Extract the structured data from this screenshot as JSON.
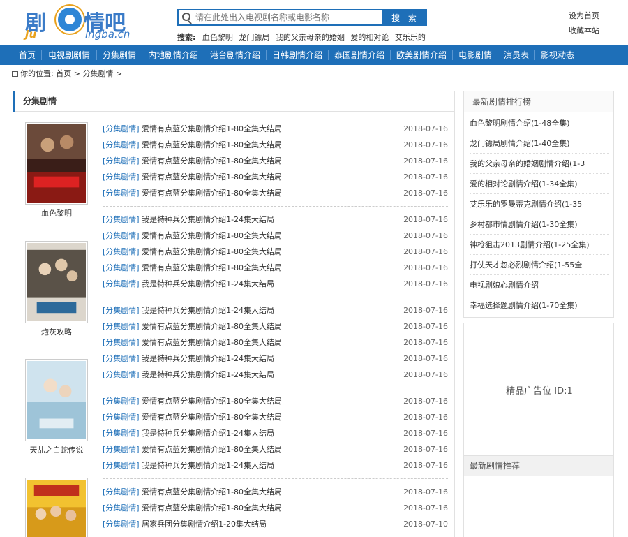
{
  "logo": {
    "brand_cn_left": "剧",
    "brand_cn_right": "情吧",
    "brand_en_left": "Ju",
    "brand_en_right": "ingba.cn"
  },
  "search": {
    "placeholder": "请在此处出入电视剧名称或电影名称",
    "button_label": "搜 索"
  },
  "hot": {
    "label": "搜索:",
    "keywords": [
      "血色黎明",
      "龙门镖局",
      "我的父亲母亲的婚姻",
      "爱的相对论",
      "艾乐乐的"
    ]
  },
  "toplinks": {
    "homepage": "设为首页",
    "favorite": "收藏本站"
  },
  "nav": [
    "首页",
    "电视剧剧情",
    "分集剧情",
    "内地剧情介绍",
    "港台剧情介绍",
    "日韩剧情介绍",
    "泰国剧情介绍",
    "欧美剧情介绍",
    "电影剧情",
    "演员表",
    "影视动态"
  ],
  "breadcrumb": {
    "prefix": "你的位置:",
    "home": "首页",
    "sep": ">",
    "current": "分集剧情"
  },
  "main": {
    "title": "分集剧情",
    "groups": [
      {
        "poster_title": "血色黎明",
        "rows": [
          {
            "tag": "[分集剧情]",
            "title": "爱情有点蓝分集剧情介绍1-80全集大结局",
            "date": "2018-07-16"
          },
          {
            "tag": "[分集剧情]",
            "title": "爱情有点蓝分集剧情介绍1-80全集大结局",
            "date": "2018-07-16"
          },
          {
            "tag": "[分集剧情]",
            "title": "爱情有点蓝分集剧情介绍1-80全集大结局",
            "date": "2018-07-16"
          },
          {
            "tag": "[分集剧情]",
            "title": "爱情有点蓝分集剧情介绍1-80全集大结局",
            "date": "2018-07-16"
          },
          {
            "tag": "[分集剧情]",
            "title": "爱情有点蓝分集剧情介绍1-80全集大结局",
            "date": "2018-07-16"
          }
        ]
      },
      {
        "poster_title": "炮灰攻略",
        "rows": [
          {
            "tag": "[分集剧情]",
            "title": "我是特种兵分集剧情介绍1-24集大结局",
            "date": "2018-07-16"
          },
          {
            "tag": "[分集剧情]",
            "title": "爱情有点蓝分集剧情介绍1-80全集大结局",
            "date": "2018-07-16"
          },
          {
            "tag": "[分集剧情]",
            "title": "爱情有点蓝分集剧情介绍1-80全集大结局",
            "date": "2018-07-16"
          },
          {
            "tag": "[分集剧情]",
            "title": "爱情有点蓝分集剧情介绍1-80全集大结局",
            "date": "2018-07-16"
          },
          {
            "tag": "[分集剧情]",
            "title": "我是特种兵分集剧情介绍1-24集大结局",
            "date": "2018-07-16"
          }
        ]
      },
      {
        "poster_title": "",
        "rows": [
          {
            "tag": "[分集剧情]",
            "title": "我是特种兵分集剧情介绍1-24集大结局",
            "date": "2018-07-16"
          },
          {
            "tag": "[分集剧情]",
            "title": "爱情有点蓝分集剧情介绍1-80全集大结局",
            "date": "2018-07-16"
          },
          {
            "tag": "[分集剧情]",
            "title": "爱情有点蓝分集剧情介绍1-80全集大结局",
            "date": "2018-07-16"
          },
          {
            "tag": "[分集剧情]",
            "title": "我是特种兵分集剧情介绍1-24集大结局",
            "date": "2018-07-16"
          },
          {
            "tag": "[分集剧情]",
            "title": "我是特种兵分集剧情介绍1-24集大结局",
            "date": "2018-07-16"
          }
        ]
      },
      {
        "poster_title": "天乩之白蛇传说",
        "rows": [
          {
            "tag": "[分集剧情]",
            "title": "爱情有点蓝分集剧情介绍1-80全集大结局",
            "date": "2018-07-16"
          },
          {
            "tag": "[分集剧情]",
            "title": "爱情有点蓝分集剧情介绍1-80全集大结局",
            "date": "2018-07-16"
          },
          {
            "tag": "[分集剧情]",
            "title": "我是特种兵分集剧情介绍1-24集大结局",
            "date": "2018-07-16"
          },
          {
            "tag": "[分集剧情]",
            "title": "爱情有点蓝分集剧情介绍1-80全集大结局",
            "date": "2018-07-16"
          },
          {
            "tag": "[分集剧情]",
            "title": "我是特种兵分集剧情介绍1-24集大结局",
            "date": "2018-07-16"
          }
        ]
      },
      {
        "poster_title": "",
        "rows": [
          {
            "tag": "[分集剧情]",
            "title": "爱情有点蓝分集剧情介绍1-80全集大结局",
            "date": "2018-07-16"
          },
          {
            "tag": "[分集剧情]",
            "title": "爱情有点蓝分集剧情介绍1-80全集大结局",
            "date": "2018-07-16"
          },
          {
            "tag": "[分集剧情]",
            "title": "居家兵团分集剧情介绍1-20集大结局",
            "date": "2018-07-10"
          }
        ]
      }
    ]
  },
  "rank": {
    "title": "最新剧情排行榜",
    "items": [
      "血色黎明剧情介绍(1-48全集)",
      "龙门镖局剧情介绍(1-40全集)",
      "我的父亲母亲的婚姻剧情介绍(1-3",
      "爱的相对论剧情介绍(1-34全集)",
      "艾乐乐的罗曼蒂克剧情介绍(1-35",
      "乡村都市情剧情介绍(1-30全集)",
      "神枪狙击2013剧情介绍(1-25全集)",
      "打仗天才忽必烈剧情介绍(1-55全",
      "电视剧娘心剧情介绍",
      "幸福选择题剧情介绍(1-70全集)"
    ]
  },
  "ad": {
    "text": "精品广告位 ID:1"
  },
  "rec": {
    "title": "最新剧情推荐"
  },
  "colors": {
    "brand_blue": "#1e6fb8",
    "logo_orange": "#e9a11b"
  }
}
